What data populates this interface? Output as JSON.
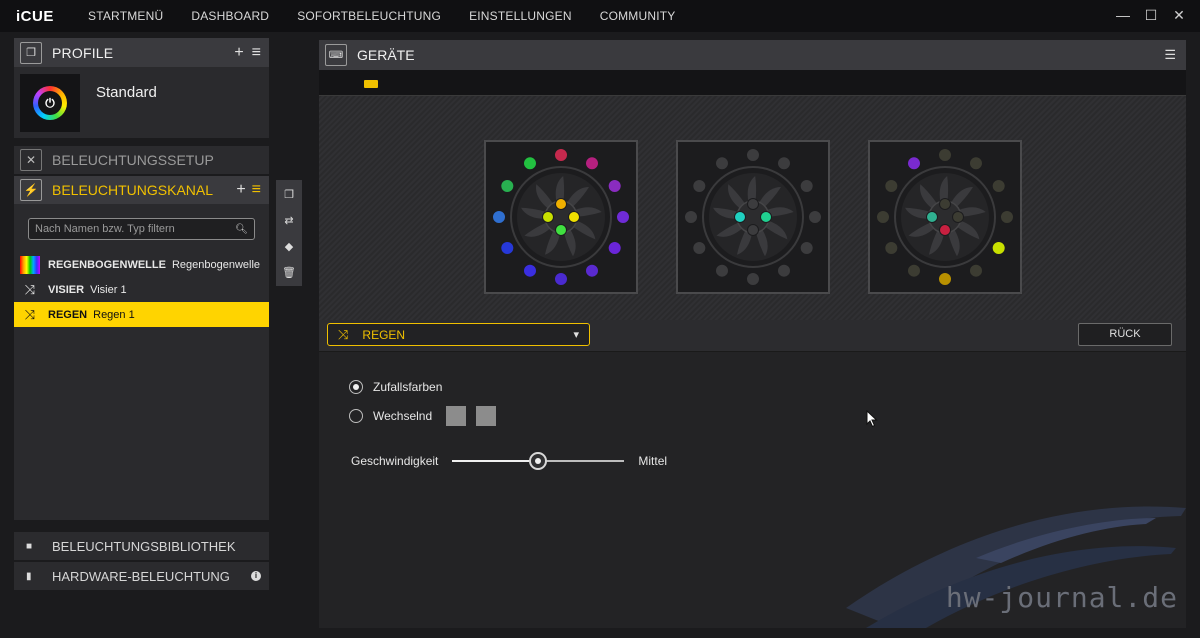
{
  "app": {
    "brand": "iCUE"
  },
  "nav": [
    "STARTMENÜ",
    "DASHBOARD",
    "SOFORTBELEUCHTUNG",
    "EINSTELLUNGEN",
    "COMMUNITY"
  ],
  "window": {
    "minimize": "—",
    "maximize": "☐",
    "close": "✕"
  },
  "profile": {
    "title": "PROFILE",
    "add": "+",
    "menu": "≡",
    "name": "Standard"
  },
  "lighting_setup": {
    "title": "BELEUCHTUNGSSETUP"
  },
  "lighting_channel": {
    "title": "BELEUCHTUNGSKANAL",
    "add": "+",
    "menu": "≡",
    "search_placeholder": "Nach Namen bzw. Typ filtern",
    "effects": [
      {
        "name": "REGENBOGENWELLE",
        "desc": "Regenbogenwelle",
        "icon": "rainbow-swatch-icon",
        "active": false
      },
      {
        "name": "VISIER",
        "desc": "Visier 1",
        "icon": "shuffle-icon",
        "active": false
      },
      {
        "name": "REGEN",
        "desc": "Regen 1",
        "icon": "shuffle-icon",
        "active": true
      }
    ]
  },
  "library": {
    "title": "BELEUCHTUNGSBIBLIOTHEK"
  },
  "hardware": {
    "title": "HARDWARE-BELEUCHTUNG"
  },
  "devices": {
    "title": "GERÄTE",
    "fans": [
      {
        "outer": [
          "#c5294d",
          "#b5207f",
          "#8a2cc0",
          "#6f2bd6",
          "#6a25d8",
          "#5a2ad0",
          "#4a2ad0",
          "#3a2ee0",
          "#2638d8",
          "#2f6fd0",
          "#28b050",
          "#22c040"
        ],
        "inner": [
          "#f0b000",
          "#c8e000",
          "#f0e000",
          "#40e040"
        ]
      },
      {
        "outer": [
          "#3c3c3e",
          "#3c3c3e",
          "#3c3c3e",
          "#3c3c3e",
          "#3c3c3e",
          "#3c3c3e",
          "#3c3c3e",
          "#3c3c3e",
          "#3c3c3e",
          "#3c3c3e",
          "#3c3c3e",
          "#3c3c3e"
        ],
        "inner": [
          "#3c3c3e",
          "#20d0c0",
          "#20d090",
          "#3c3c3e"
        ]
      },
      {
        "outer": [
          "#3c3c32",
          "#3c3c32",
          "#3c3c32",
          "#3c3c32",
          "#c8e000",
          "#3c3c32",
          "#b89000",
          "#3c3c32",
          "#3c3c32",
          "#3c3c32",
          "#3c3c32",
          "#7a2ad0"
        ],
        "inner": [
          "#3c3c32",
          "#30b090",
          "#3c3c32",
          "#c82040"
        ]
      }
    ]
  },
  "effect_settings": {
    "selected_effect": "REGEN",
    "back_label": "RÜCK",
    "option_random": "Zufallsfarben",
    "option_alternating": "Wechselnd",
    "speed_label": "Geschwindigkeit",
    "speed_value_label": "Mittel",
    "speed_fraction": 0.5,
    "selected_option": "random"
  },
  "watermark": "hw-journal.de",
  "colors": {
    "accent": "#f0c000",
    "panel": "#3a3a3e",
    "background": "#1b1b1d"
  }
}
